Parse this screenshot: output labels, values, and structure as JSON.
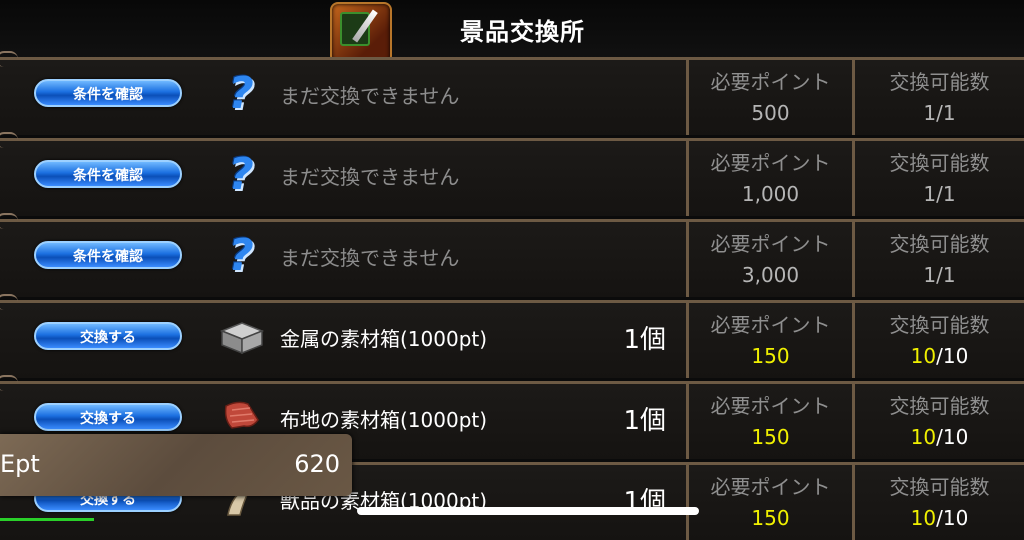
{
  "header": {
    "title": "景品交換所",
    "icon": "shop-sword-icon"
  },
  "columns": {
    "points_label": "必要ポイント",
    "count_label": "交換可能数"
  },
  "rows": [
    {
      "button": "条件を確認",
      "icon": "question-icon",
      "name": "まだ交換できません",
      "locked": true,
      "quantity": "",
      "points": "500",
      "count_current": "1",
      "count_total": "1",
      "count": "1/1"
    },
    {
      "button": "条件を確認",
      "icon": "question-icon",
      "name": "まだ交換できません",
      "locked": true,
      "quantity": "",
      "points": "1,000",
      "count_current": "1",
      "count_total": "1",
      "count": "1/1"
    },
    {
      "button": "条件を確認",
      "icon": "question-icon",
      "name": "まだ交換できません",
      "locked": true,
      "quantity": "",
      "points": "3,000",
      "count_current": "1",
      "count_total": "1",
      "count": "1/1"
    },
    {
      "button": "交換する",
      "icon": "metal-box-icon",
      "name": "金属の素材箱(1000pt)",
      "locked": false,
      "quantity": "1個",
      "points": "150",
      "count_current": "10",
      "count_total": "10"
    },
    {
      "button": "交換する",
      "icon": "cloth-icon",
      "name": "布地の素材箱(1000pt)",
      "locked": false,
      "quantity": "1個",
      "points": "150",
      "count_current": "10",
      "count_total": "10"
    },
    {
      "button": "交換する",
      "icon": "fang-icon",
      "name": "獣品の素材箱(1000pt)",
      "locked": false,
      "quantity": "1個",
      "points": "150",
      "count_current": "10",
      "count_total": "10"
    }
  ],
  "ept": {
    "label": "Ept",
    "value": "620"
  },
  "colors": {
    "accent_yellow": "#f0f000",
    "button_blue": "#1b6fe0",
    "frame": "#6d5a44"
  }
}
